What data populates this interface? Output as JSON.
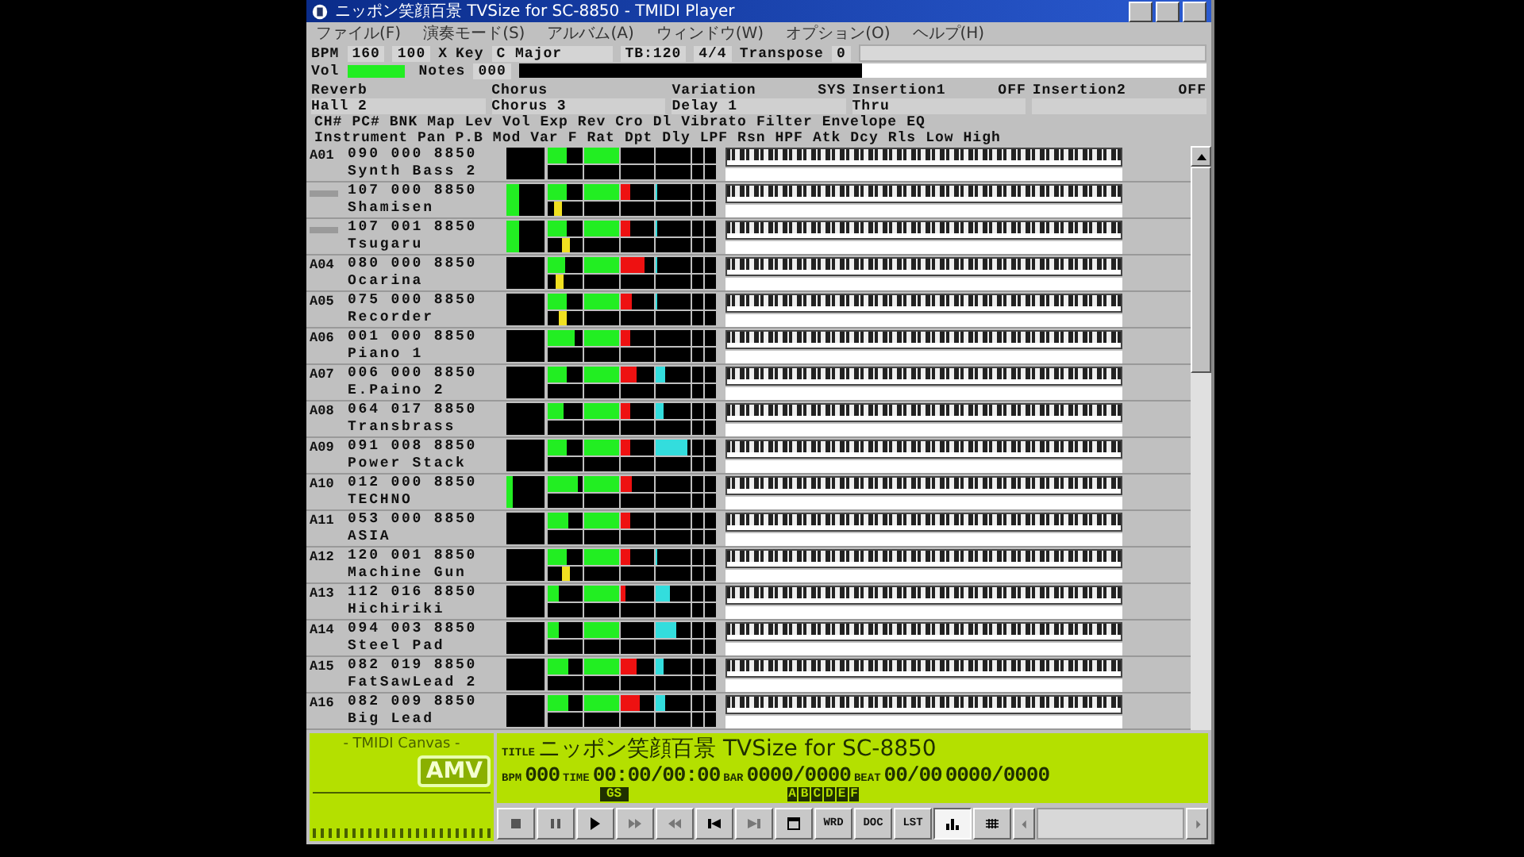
{
  "window": {
    "title": "ニッポン笑顔百景 TVSize for SC-8850 - TMIDI Player"
  },
  "menu": [
    "ファイル(F)",
    "演奏モード(S)",
    "アルバム(A)",
    "ウィンドウ(W)",
    "オプション(O)",
    "ヘルプ(H)"
  ],
  "info": {
    "bpm_label": "BPM",
    "bpm": "160",
    "percent": "100",
    "percent_unit": "X",
    "key_label": "Key",
    "key": "C Major",
    "tb": "TB:120",
    "meter": "4/4",
    "transpose_label": "Transpose",
    "transpose": "0",
    "vol_label": "Vol",
    "vol": {
      "level": 0.9
    },
    "notes_label": "Notes",
    "notes": "000",
    "notes_bar": {
      "level": 0.5
    }
  },
  "effects": [
    {
      "name": "Reverb",
      "value": "Hall 2"
    },
    {
      "name": "Chorus",
      "value": "Chorus 3"
    },
    {
      "name": "Variation",
      "state": "SYS",
      "value": "Delay 1"
    },
    {
      "name": "Insertion1",
      "state": "OFF",
      "value": "Thru"
    },
    {
      "name": "Insertion2",
      "state": "OFF"
    }
  ],
  "columns_top": [
    "CH#",
    "PC#",
    "BNK",
    "Map",
    "Lev",
    "Vol",
    "Exp",
    "Rev",
    "Cro",
    "Dl",
    "Vibrato",
    "Filter",
    "Envelope",
    "EQ"
  ],
  "columns_bottom": [
    "Instrument",
    "Pan",
    "P.B",
    "Mod",
    "Var",
    "F",
    "Rat",
    "Dpt",
    "Dly",
    "LPF",
    "Rsn",
    "HPF",
    "Atk",
    "Dcy",
    "Rls",
    "Low",
    "High"
  ],
  "channels": [
    {
      "channel": "A01",
      "program": "090 000 8850",
      "instrument": "Synth Bass 2",
      "volume": {
        "level": 0.55
      },
      "expression": {
        "level": 1
      }
    },
    {
      "program": "107 000 8850",
      "instrument": "Shamisen",
      "lev": {
        "level": 0.35
      },
      "volume": {
        "level": 0.55
      },
      "expression": {
        "level": 1
      },
      "reverb": {
        "level": 0.3
      },
      "chorus": {
        "level": 0.05
      },
      "pan": {
        "level": 0.3
      }
    },
    {
      "program": "107 001 8850",
      "instrument": "Tsugaru",
      "lev": {
        "level": 0.35
      },
      "volume": {
        "level": 0.55
      },
      "expression": {
        "level": 1
      },
      "reverb": {
        "level": 0.3
      },
      "chorus": {
        "level": 0.05
      },
      "pan": {
        "level": 0.55
      }
    },
    {
      "channel": "A04",
      "program": "080 000 8850",
      "instrument": "Ocarina",
      "volume": {
        "level": 0.5
      },
      "expression": {
        "level": 1
      },
      "reverb": {
        "level": 0.7
      },
      "chorus": {
        "level": 0.05
      },
      "pan": {
        "level": 0.35
      }
    },
    {
      "channel": "A05",
      "program": "075 000 8850",
      "instrument": "Recorder",
      "volume": {
        "level": 0.55
      },
      "expression": {
        "level": 1
      },
      "reverb": {
        "level": 0.35
      },
      "chorus": {
        "level": 0.05
      },
      "pan": {
        "level": 0.45
      }
    },
    {
      "channel": "A06",
      "program": "001 000 8850",
      "instrument": "Piano 1",
      "volume": {
        "level": 0.8
      },
      "expression": {
        "level": 1
      },
      "reverb": {
        "level": 0.3
      }
    },
    {
      "channel": "A07",
      "program": "006 000 8850",
      "instrument": "E.Paino 2",
      "volume": {
        "level": 0.55
      },
      "expression": {
        "level": 1
      },
      "reverb": {
        "level": 0.5
      },
      "chorus": {
        "level": 0.25
      }
    },
    {
      "channel": "A08",
      "program": "064 017 8850",
      "instrument": "Transbrass",
      "volume": {
        "level": 0.45
      },
      "expression": {
        "level": 1
      },
      "reverb": {
        "level": 0.3
      },
      "chorus": {
        "level": 0.2
      }
    },
    {
      "channel": "A09",
      "program": "091 008 8850",
      "instrument": "Power Stack",
      "volume": {
        "level": 0.55
      },
      "expression": {
        "level": 1
      },
      "reverb": {
        "level": 0.3
      },
      "chorus": {
        "level": 0.9
      }
    },
    {
      "channel": "A10",
      "program": "012 000 8850",
      "instrument": "TECHNO",
      "lev": {
        "level": 0.15
      },
      "volume": {
        "level": 0.85
      },
      "expression": {
        "level": 1
      },
      "reverb": {
        "level": 0.35
      }
    },
    {
      "channel": "A11",
      "program": "053 000 8850",
      "instrument": "ASIA",
      "volume": {
        "level": 0.6
      },
      "expression": {
        "level": 1
      },
      "reverb": {
        "level": 0.3
      }
    },
    {
      "channel": "A12",
      "program": "120 001 8850",
      "instrument": "Machine Gun",
      "volume": {
        "level": 0.55
      },
      "expression": {
        "level": 1
      },
      "reverb": {
        "level": 0.3
      },
      "chorus": {
        "level": 0.05
      },
      "pan": {
        "level": 0.55
      }
    },
    {
      "channel": "A13",
      "program": "112 016 8850",
      "instrument": "Hichiriki",
      "volume": {
        "level": 0.3
      },
      "expression": {
        "level": 1
      },
      "reverb": {
        "level": 0.15
      },
      "chorus": {
        "level": 0.4
      }
    },
    {
      "channel": "A14",
      "program": "094 003 8850",
      "instrument": "Steel Pad",
      "volume": {
        "level": 0.3
      },
      "expression": {
        "level": 1
      },
      "chorus": {
        "level": 0.6
      }
    },
    {
      "channel": "A15",
      "program": "082 019 8850",
      "instrument": "FatSawLead 2",
      "volume": {
        "level": 0.6
      },
      "expression": {
        "level": 1
      },
      "reverb": {
        "level": 0.5
      },
      "chorus": {
        "level": 0.2
      }
    },
    {
      "channel": "A16",
      "program": "082 009 8850",
      "instrument": "Big Lead",
      "volume": {
        "level": 0.6
      },
      "expression": {
        "level": 1
      },
      "reverb": {
        "level": 0.55
      },
      "chorus": {
        "level": 0.25
      }
    }
  ],
  "canvas": {
    "title": "- TMIDI Canvas -",
    "logo": "AMV"
  },
  "display": {
    "title_label": "TITLE",
    "title": "ニッポン笑顔百景 TVSize for SC-8850",
    "bpm_label": "BPM",
    "bpm": "000",
    "time_label": "TIME",
    "time": "00:00/00:00",
    "bar_label": "BAR",
    "bar": "0000/0000",
    "beat_label": "BEAT",
    "beat": "00/00",
    "tick": "0000/0000",
    "mode": "GS",
    "parts": [
      "A",
      "B",
      "C",
      "D",
      "E",
      "F"
    ]
  },
  "toolbar": [
    {
      "kind": "icon",
      "selected": false
    },
    {
      "kind": "icon",
      "selected": false
    },
    {
      "kind": "icon",
      "selected": false
    },
    {
      "kind": "icon",
      "selected": false
    },
    {
      "kind": "icon",
      "selected": false
    },
    {
      "kind": "icon",
      "selected": false
    },
    {
      "kind": "icon",
      "selected": false
    },
    {
      "kind": "icon",
      "selected": false
    },
    {
      "kind": "text",
      "label": "WRD",
      "selected": false
    },
    {
      "kind": "text",
      "label": "DOC",
      "selected": false
    },
    {
      "kind": "text",
      "label": "LST",
      "selected": false
    },
    {
      "kind": "icon",
      "selected": true
    },
    {
      "kind": "icon",
      "selected": false
    }
  ]
}
